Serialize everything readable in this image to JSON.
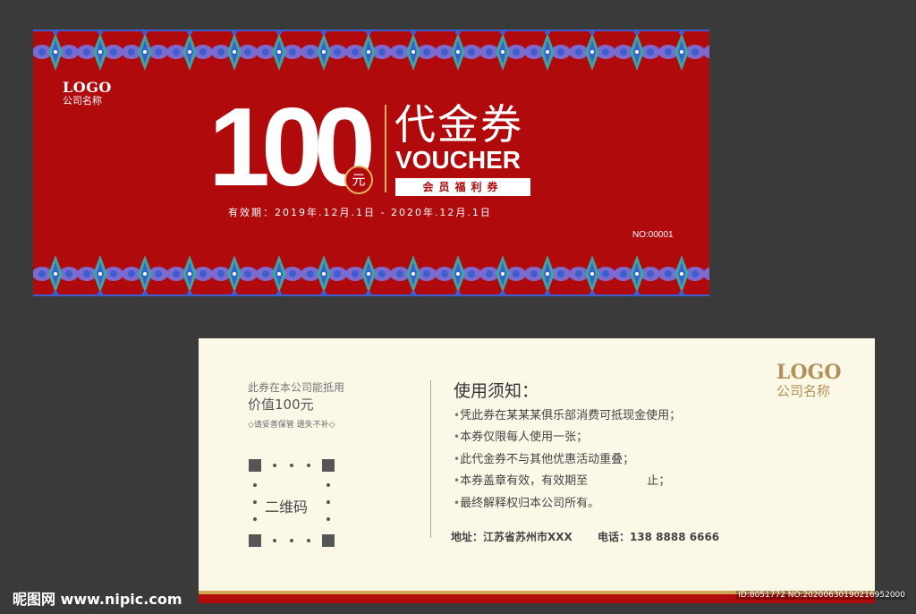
{
  "colors": {
    "red": "#b00a0c",
    "gold": "#e3b35a",
    "cream": "#fcf8e8",
    "pattern_blue": "#3b5fd1",
    "pattern_purple": "#7b6fd8",
    "pattern_teal": "#3fa3a0"
  },
  "front": {
    "logo_word": "LOGO",
    "logo_company": "公司名称",
    "amount": "100",
    "currency": "元",
    "title_cn": "代金券",
    "title_en": "VOUCHER",
    "member_tag": "会员福利券",
    "validity": "有效期：2019年.12月.1日 - 2020年.12月.1日",
    "serial": "NO:00001",
    "border_pattern": "ornamental-scroll-border"
  },
  "back": {
    "line1": "此券在本公司能抵用",
    "line2": "价值100元",
    "line3": "◇请妥善保管 遗失不补◇",
    "qr_label": "二维码",
    "rules_title": "使用须知：",
    "rules": [
      "凭此券在某某某俱乐部消费可抵现金使用；",
      "本券仅限每人使用一张；",
      "此代金券不与其他优惠活动重叠；",
      "本券盖章有效，有效期至                止；",
      "最终解释权归本公司所有。"
    ],
    "address": "地址：江苏省苏州市XXX",
    "phone": "电话：138 8888 6666",
    "logo_word": "LOGO",
    "logo_company": "公司名称"
  },
  "watermark": {
    "site": "昵图网 www.nipic.com",
    "id": "ID:8051772 NO:20200630190216952000"
  }
}
